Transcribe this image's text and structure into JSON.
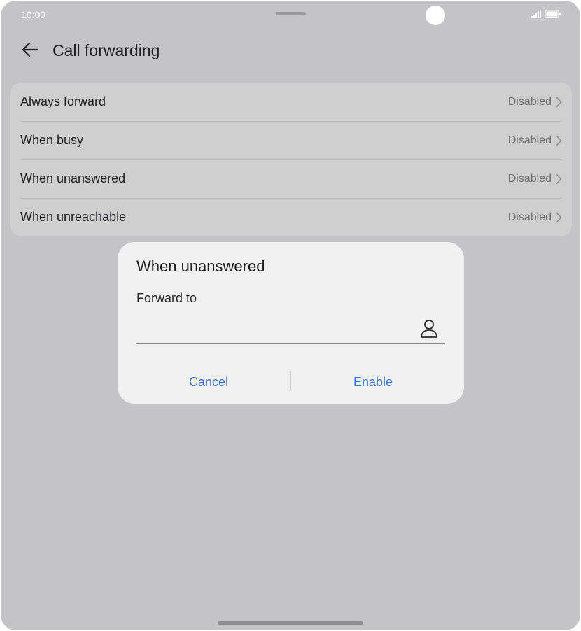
{
  "status_bar": {
    "time": "10:00",
    "icons": [
      "signal-icon",
      "battery-icon"
    ]
  },
  "header": {
    "title": "Call forwarding",
    "back_icon": "arrow-left-icon"
  },
  "settings": {
    "items": [
      {
        "label": "Always forward",
        "status": "Disabled"
      },
      {
        "label": "When busy",
        "status": "Disabled"
      },
      {
        "label": "When unanswered",
        "status": "Disabled"
      },
      {
        "label": "When unreachable",
        "status": "Disabled"
      }
    ]
  },
  "dialog": {
    "title": "When unanswered",
    "field_label": "Forward to",
    "field_value": "",
    "contact_icon": "person-icon",
    "cancel_label": "Cancel",
    "enable_label": "Enable"
  },
  "colors": {
    "accent": "#3a72d8",
    "scrim_background": "#c4c4c6",
    "dialog_background": "#f0f0f0"
  }
}
